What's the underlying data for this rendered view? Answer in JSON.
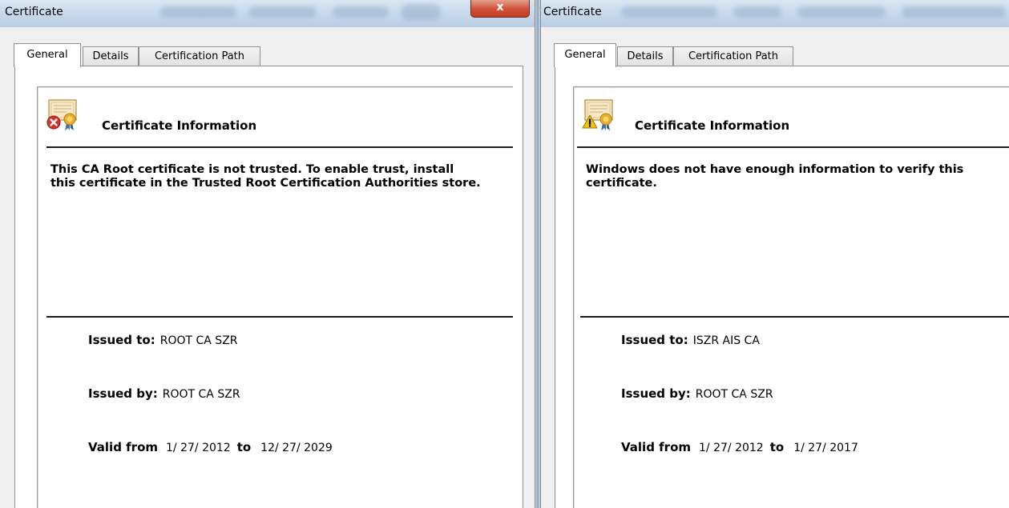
{
  "colors": {
    "titlebar": "#c6d8ea",
    "close_button": "#d2553e",
    "error_badge": "#d8312a",
    "warning_badge": "#f2c200",
    "seal": "#e6b02a"
  },
  "windows": [
    {
      "title": "Certificate",
      "close_label": "x",
      "tabs": [
        "General",
        "Details",
        "Certification Path"
      ],
      "active_tab": "General",
      "icon": "certificate-error-icon",
      "info_header": "Certificate Information",
      "status_text": "This CA Root certificate is not trusted. To enable trust, install this certificate in the Trusted Root Certification Authorities store.",
      "issued_to_label": "Issued to:",
      "issued_to": "ROOT CA SZR",
      "issued_by_label": "Issued by:",
      "issued_by": "ROOT CA SZR",
      "valid_from_label": "Valid from",
      "valid_from": "1/ 27/ 2012",
      "to_label": "to",
      "valid_to": "12/ 27/ 2029"
    },
    {
      "title": "Certificate",
      "tabs": [
        "General",
        "Details",
        "Certification Path"
      ],
      "active_tab": "General",
      "icon": "certificate-warning-icon",
      "info_header": "Certificate Information",
      "status_text": "Windows does not have enough information to verify this certificate.",
      "issued_to_label": "Issued to:",
      "issued_to": "ISZR AIS CA",
      "issued_by_label": "Issued by:",
      "issued_by": "ROOT CA SZR",
      "valid_from_label": "Valid from",
      "valid_from": "1/ 27/ 2012",
      "to_label": "to",
      "valid_to": "1/ 27/ 2017"
    }
  ]
}
